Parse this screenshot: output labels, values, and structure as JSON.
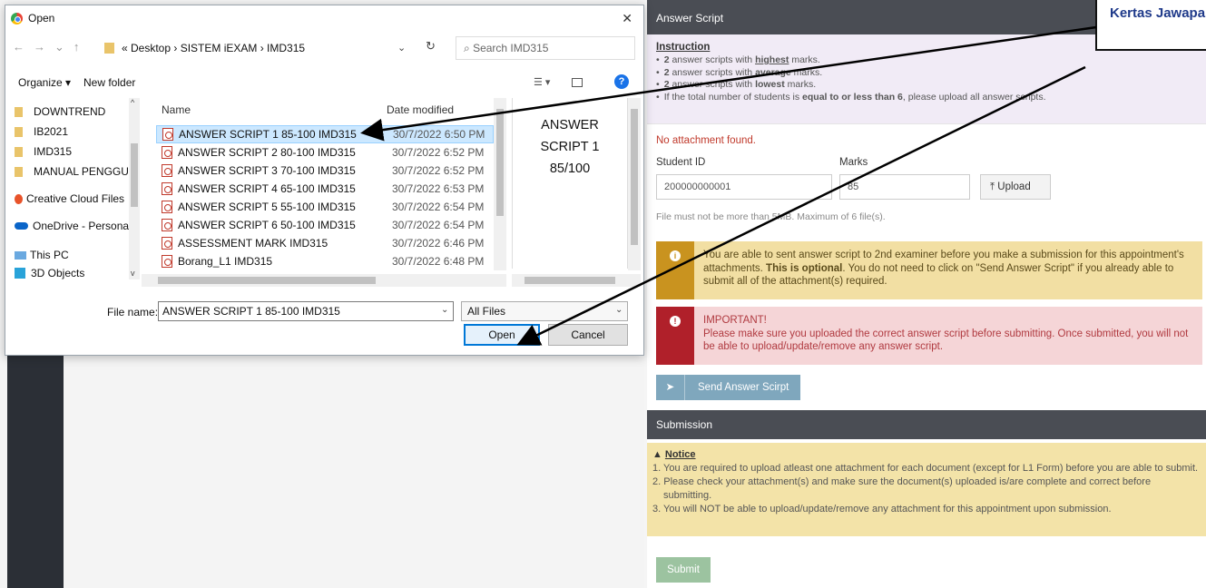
{
  "dialog": {
    "title": "Open",
    "close_glyph": "✕",
    "breadcrumb": "«  Desktop  ›  SISTEM iEXAM  ›  IMD315",
    "search_placeholder": "Search IMD315",
    "organize": "Organize ▾",
    "new_folder": "New folder",
    "nav_tree": [
      {
        "label": "DOWNTREND",
        "icon": "folder-icon"
      },
      {
        "label": "IB2021",
        "icon": "folder-icon"
      },
      {
        "label": "IMD315",
        "icon": "folder-icon"
      },
      {
        "label": "MANUAL PENGGUNA",
        "icon": "folder-icon"
      },
      {
        "label": "Creative Cloud Files",
        "icon": "creative-cloud-icon"
      },
      {
        "label": "OneDrive - Personal",
        "icon": "onedrive-icon"
      },
      {
        "label": "This PC",
        "icon": "this-pc-icon"
      },
      {
        "label": "3D Objects",
        "icon": "3d-objects-icon"
      }
    ],
    "columns": {
      "name": "Name",
      "date": "Date modified"
    },
    "files": [
      {
        "name": "ANSWER SCRIPT 1 85-100 IMD315",
        "date": "30/7/2022 6:50 PM",
        "selected": true
      },
      {
        "name": "ANSWER SCRIPT 2 80-100 IMD315",
        "date": "30/7/2022 6:52 PM"
      },
      {
        "name": "ANSWER SCRIPT 3 70-100 IMD315",
        "date": "30/7/2022 6:52 PM"
      },
      {
        "name": "ANSWER SCRIPT 4 65-100 IMD315",
        "date": "30/7/2022 6:53 PM"
      },
      {
        "name": "ANSWER SCRIPT 5 55-100 IMD315",
        "date": "30/7/2022 6:54 PM"
      },
      {
        "name": "ANSWER SCRIPT 6 50-100 IMD315",
        "date": "30/7/2022 6:54 PM"
      },
      {
        "name": "ASSESSMENT MARK IMD315",
        "date": "30/7/2022 6:46 PM"
      },
      {
        "name": "Borang_L1 IMD315",
        "date": "30/7/2022 6:48 PM"
      }
    ],
    "preview_lines": [
      "ANSWER",
      "SCRIPT 1",
      "85/100"
    ],
    "file_name_label": "File name:",
    "file_name_value": "ANSWER SCRIPT 1 85-100 IMD315",
    "file_type": "All Files",
    "open_label": "Open",
    "cancel_label": "Cancel"
  },
  "panel": {
    "header": "Answer Script",
    "instruction_title": "Instruction",
    "instructions": [
      {
        "a": "2",
        "b": " answer scripts with ",
        "c": "highest",
        "d": " marks."
      },
      {
        "a": "2",
        "b": " answer scripts with ",
        "c": "average",
        "d": " marks."
      },
      {
        "a": "2",
        "b": " answer scripts with ",
        "c": "lowest",
        "d": " marks."
      },
      {
        "a": "",
        "b": "If the total number of students is ",
        "c": "equal to or less than 6",
        "d": ", please upload all answer scripts."
      }
    ],
    "no_attachment": "No attachment found.",
    "student_id_label": "Student ID",
    "marks_label": "Marks",
    "student_id_value": "200000000001",
    "marks_value": "85",
    "upload_label": "⤒ Upload",
    "hint": "File must not be more than 5MB. Maximum of 6 file(s).",
    "warn_text_1": "You are able to sent answer script to 2nd examiner before you make a submission for this appointment's attachments. ",
    "warn_bold": "This is optional",
    "warn_text_2": ". You do not need to click on \"Send Answer Script\" if you already able to submit all of the attachment(s) required.",
    "danger_title": "IMPORTANT!",
    "danger_text": "Please make sure you uploaded the correct answer script before submitting. Once submitted, you will not be able to upload/update/remove any answer script.",
    "send_label": "Send Answer Scirpt",
    "submission_header": "Submission",
    "notice_title": "Notice",
    "notices": [
      "1. You are required to upload atleast one attachment for each document (except for L1 Form) before you are able to submit.",
      "2. Please check your attachment(s) and make sure the document(s) uploaded is/are complete and correct before submitting.",
      "3. You will NOT be able to upload/update/remove any attachment for this appointment upon submission."
    ],
    "submit_label": "Submit"
  },
  "callout": "Kertas Jawapan",
  "colors": {
    "panel_header": "#4a4d54",
    "warning": "#f2dfa3",
    "danger": "#f5d5d7",
    "accent": "#0078d7"
  }
}
